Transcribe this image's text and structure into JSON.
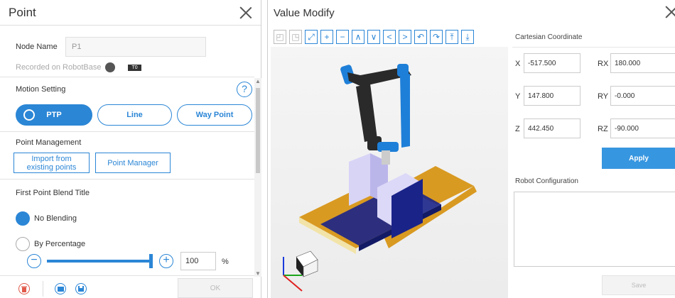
{
  "point_panel": {
    "title": "Point",
    "node_name_label": "Node Name",
    "node_name_value": "P1",
    "recorded_on_label": "Recorded on  RobotBase",
    "tool_badge": "T0",
    "motion_setting_label": "Motion Setting",
    "help_glyph": "?",
    "motion_options": [
      "PTP",
      "Line",
      "Way Point"
    ],
    "selected_motion": "PTP",
    "point_management_label": "Point Management",
    "import_label_line1": "Import from",
    "import_label_line2": "existing points",
    "point_manager_label": "Point Manager",
    "blend_title": "First Point Blend Title",
    "no_blending_label": "No Blending",
    "by_percentage_label": "By Percentage",
    "blend_percent": "100",
    "percent_unit": "%",
    "ok_label": "OK",
    "slider_fraction": 1.0
  },
  "value_modify": {
    "title": "Value Modify",
    "cartesian_title": "Cartesian Coordinate",
    "x_label": "X",
    "x_value": "-517.500",
    "y_label": "Y",
    "y_value": "147.800",
    "z_label": "Z",
    "z_value": "442.450",
    "rx_label": "RX",
    "rx_value": "180.000",
    "ry_label": "RY",
    "ry_value": "-0.000",
    "rz_label": "RZ",
    "rz_value": "-90.000",
    "apply_label": "Apply",
    "robot_config_title": "Robot Configuration",
    "save_label": "Save"
  },
  "toolbar_icons": [
    "view-front-icon",
    "view-top-icon",
    "link-icon",
    "plus-icon",
    "minus-icon",
    "up-icon",
    "down-icon",
    "left-icon",
    "right-icon",
    "rotate-left-icon",
    "rotate-right-icon",
    "rotate-up-icon",
    "rotate-down-icon"
  ],
  "colors": {
    "accent": "#2b86d6",
    "robot_blue": "#1e7fd8",
    "pallet": "#d99a22",
    "dark_navy": "#1a2388"
  }
}
